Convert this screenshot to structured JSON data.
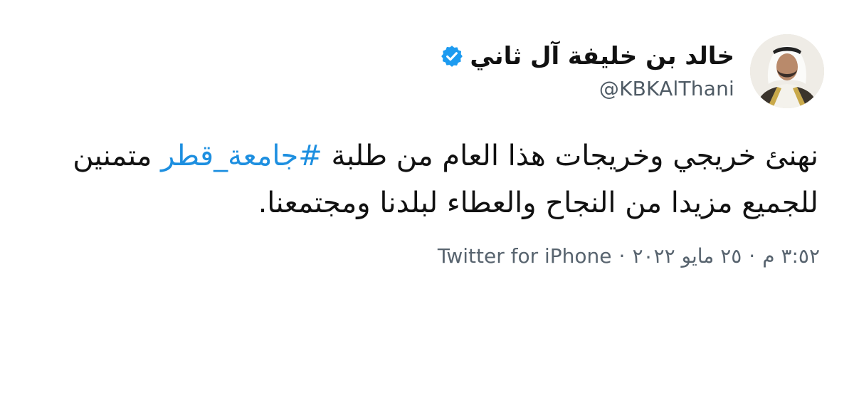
{
  "author": {
    "name": "خالد بن خليفة آل ثاني",
    "handle": "@KBKAlThani",
    "verified": true,
    "avatar_icon": "profile-photo",
    "verified_icon": "verified-badge-icon",
    "verified_color": "#1d9bf0"
  },
  "tweet": {
    "text_before": "نهنئ خريجي وخريجات هذا العام من طلبة ",
    "hashtag": "#جامعة_قطر",
    "text_after": " متمنين للجميع مزيدا من النجاح والعطاء لبلدنا ومجتمعنا.",
    "hashtag_color": "#1d8fe0"
  },
  "meta": {
    "time": "٣:٥٢ م",
    "date": "٢٥ مايو ٢٠٢٢",
    "source": "Twitter for iPhone",
    "separator": "·"
  }
}
